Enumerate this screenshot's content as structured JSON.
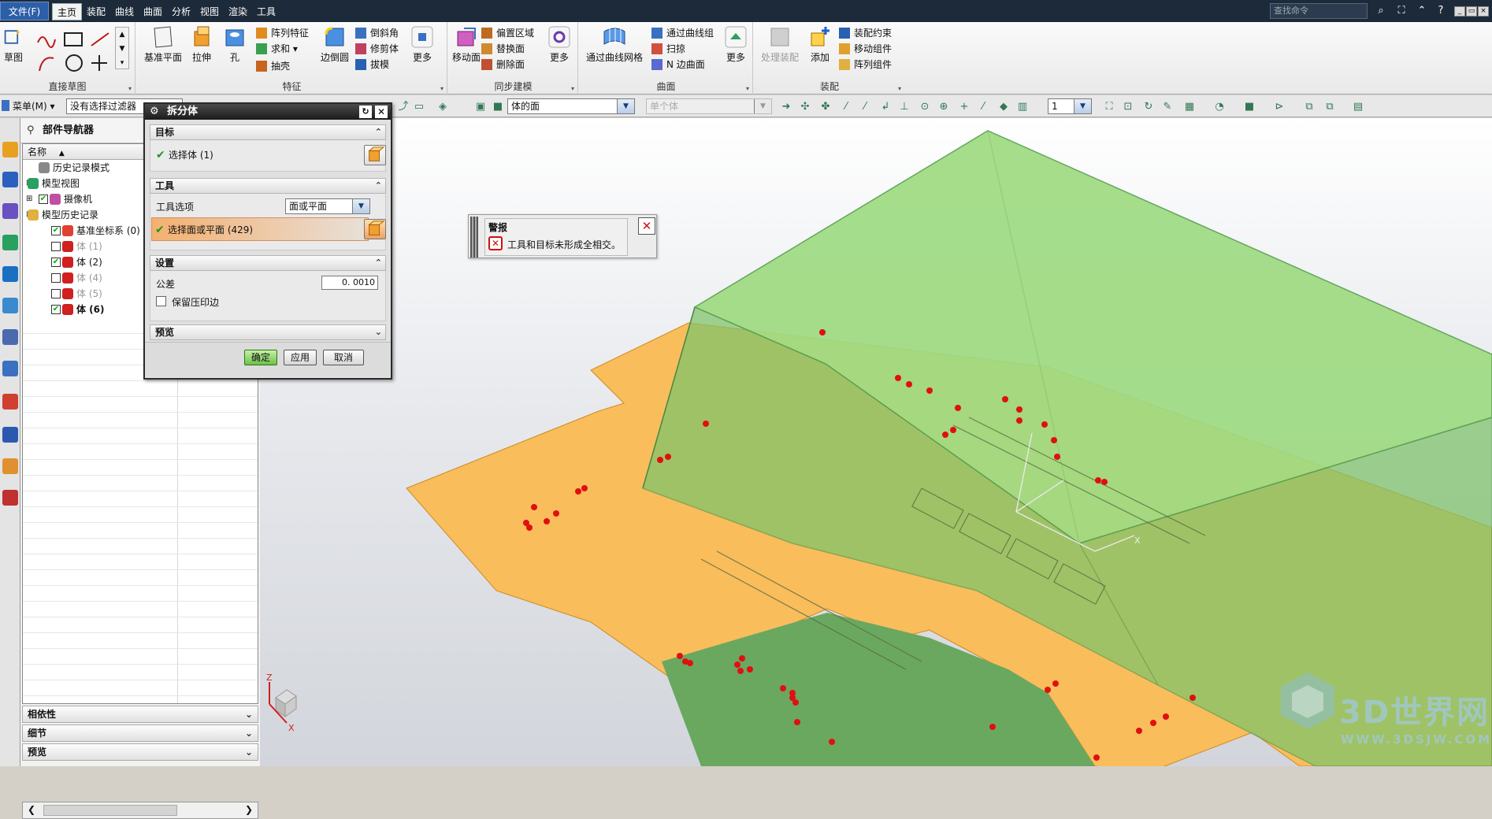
{
  "menubar": {
    "file": "文件(F)",
    "tabs": [
      "主页",
      "装配",
      "曲线",
      "曲面",
      "分析",
      "视图",
      "渲染",
      "工具"
    ],
    "search_placeholder": "查找命令"
  },
  "ribbon": {
    "groups": {
      "direct_sketch": {
        "label": "直接草图",
        "sketch": "草图"
      },
      "feature": {
        "label": "特征",
        "datum_plane": "基准平面",
        "extrude": "拉伸",
        "hole": "孔",
        "pattern": "阵列特征",
        "unite": "求和",
        "shell": "抽壳",
        "edge_blend": "边倒圆",
        "chamfer": "倒斜角",
        "trim_body": "修剪体",
        "draft": "拔模",
        "more": "更多"
      },
      "sync": {
        "label": "同步建模",
        "move_face": "移动面",
        "offset_region": "偏置区域",
        "replace_face": "替换面",
        "delete_face": "删除面",
        "more": "更多"
      },
      "surface": {
        "label": "曲面",
        "through_curve_mesh": "通过曲线网格",
        "through_curves": "通过曲线组",
        "sweep": "扫掠",
        "n_sided": "N 边曲面",
        "more": "更多"
      },
      "assembly": {
        "label": "装配",
        "process_assembly": "处理装配",
        "add": "添加",
        "constraints": "装配约束",
        "move_component": "移动组件",
        "pattern_component": "阵列组件"
      }
    }
  },
  "toolbar": {
    "menu": "菜单(M)",
    "filter": "没有选择过滤器",
    "face_rule": "体的面",
    "body_rule": "单个体",
    "layer": "1"
  },
  "navigator": {
    "title": "部件导航器",
    "column": "名称",
    "items": [
      {
        "label": "历史记录模式",
        "checked": null
      },
      {
        "label": "模型视图",
        "checked": null
      },
      {
        "label": "摄像机",
        "checked": true
      },
      {
        "label": "模型历史记录",
        "checked": null
      },
      {
        "label": "基准坐标系 (0)",
        "checked": true
      },
      {
        "label": "体 (1)",
        "checked": false
      },
      {
        "label": "体 (2)",
        "checked": true
      },
      {
        "label": "体 (4)",
        "checked": false
      },
      {
        "label": "体 (5)",
        "checked": false
      },
      {
        "label": "体 (6)",
        "checked": true
      }
    ],
    "sections": [
      "相依性",
      "细节",
      "预览"
    ]
  },
  "dialog": {
    "title": "拆分体",
    "target_section": "目标",
    "target_select": "选择体 (1)",
    "tool_section": "工具",
    "tool_option_label": "工具选项",
    "tool_option_value": "面或平面",
    "tool_select": "选择面或平面 (429)",
    "settings_section": "设置",
    "tolerance_label": "公差",
    "tolerance_value": "0. 0010",
    "keep_imprint": "保留压印边",
    "preview_section": "预览",
    "ok": "确定",
    "apply": "应用",
    "cancel": "取消"
  },
  "alert": {
    "title": "警报",
    "message": "工具和目标未形成全相交。"
  },
  "triad": {
    "z": "Z",
    "x": "X",
    "wcs_x": "X"
  },
  "watermark": {
    "main": "3D世界网",
    "sub": "WWW.3DSJW.COM"
  },
  "colors": {
    "accent": "#2d5fa8",
    "green_body": "#7ed56f",
    "orange_body": "#f9bd5c",
    "error": "#d01010"
  }
}
